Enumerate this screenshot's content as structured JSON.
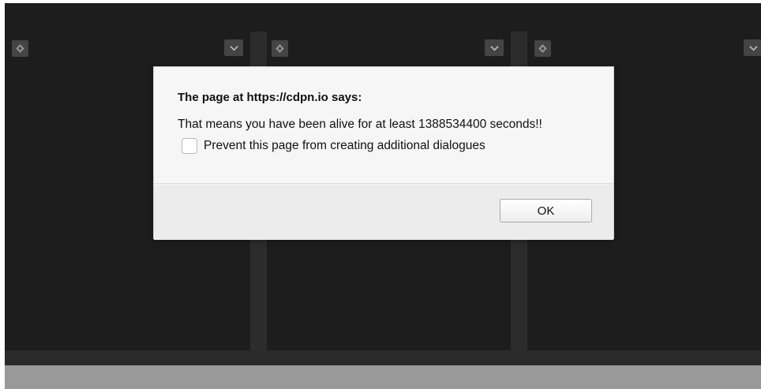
{
  "dialog": {
    "title": "The page at https://cdpn.io says:",
    "message": "That means you have been alive for at least 1388534400 seconds!!",
    "prevent_label": "Prevent this page from creating additional dialogues",
    "prevent_checked": false,
    "ok_label": "OK"
  },
  "panes": [
    {
      "settings_icon": "gear-icon",
      "menu_icon": "chevron-down-icon"
    },
    {
      "settings_icon": "gear-icon",
      "menu_icon": "chevron-down-icon"
    },
    {
      "settings_icon": "gear-icon",
      "menu_icon": "chevron-down-icon"
    }
  ],
  "colors": {
    "editor_bg": "#1d1d1d",
    "divider": "#2c2c2c",
    "footer": "#999999",
    "dialog_bg": "#f6f6f6"
  }
}
